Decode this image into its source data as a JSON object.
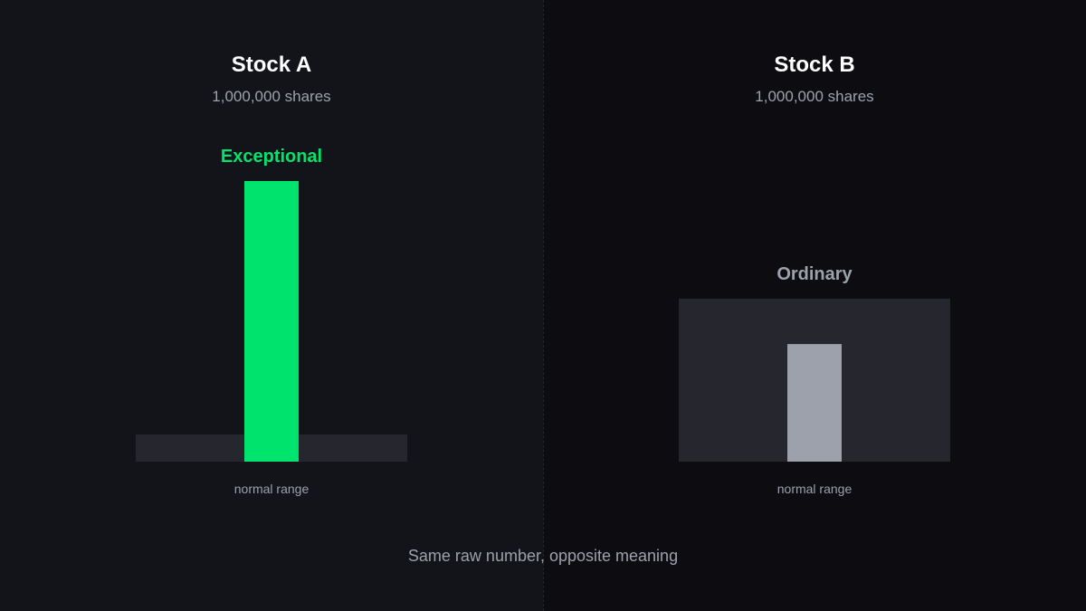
{
  "colors": {
    "background_left": "#131419",
    "background_right": "#0d0d11",
    "range_band": "#25262e",
    "accent_exceptional": "#00e46e",
    "bar_ordinary": "#9ca1ab",
    "title": "#ffffff",
    "muted_text": "#9ca1ab"
  },
  "caption": "Same raw number, opposite meaning",
  "chart_data": [
    {
      "type": "bar",
      "title": "Stock A",
      "subtitle": "1,000,000 shares",
      "verdict": "Exceptional",
      "range_label": "normal range",
      "value": 1.0,
      "normal_range": [
        0,
        0.097
      ],
      "ylim": [
        0,
        1
      ],
      "grid": false,
      "verdict_color": "#00e46e",
      "bar_color": "#00e46e"
    },
    {
      "type": "bar",
      "title": "Stock B",
      "subtitle": "1,000,000 shares",
      "verdict": "Ordinary",
      "range_label": "normal range",
      "value": 0.419,
      "normal_range": [
        0,
        0.581
      ],
      "ylim": [
        0,
        1
      ],
      "grid": false,
      "verdict_color": "#9ca1ab",
      "bar_color": "#9ca1ab"
    }
  ]
}
